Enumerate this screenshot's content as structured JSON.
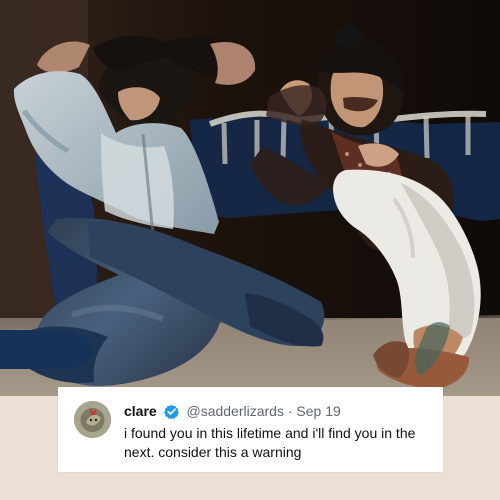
{
  "tweet": {
    "display_name": "clare",
    "handle": "@sadderlizards",
    "separator": "·",
    "date": "Sep 19",
    "text": "i found you in this lifetime and i'll find you in the next. consider this a warning",
    "verified_badge": "verified-check-icon",
    "verified_color": "#1d9bf0"
  },
  "colors": {
    "background": "#ece0d4",
    "card": "#ffffff",
    "text": "#111111",
    "muted": "#5f6870"
  }
}
